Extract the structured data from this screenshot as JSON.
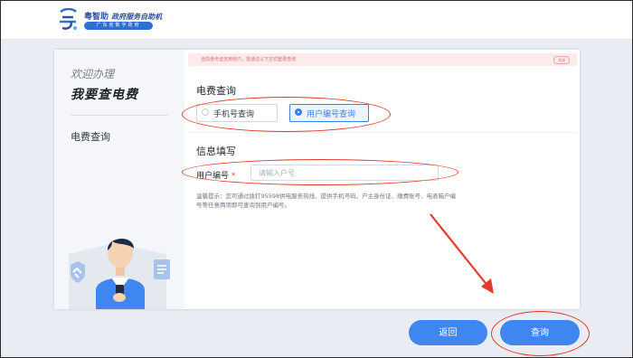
{
  "header": {
    "logo_icon": "yue-logo-icon",
    "brand_name": "粤智助",
    "brand_sub": "政府服务自助机",
    "brand_pill": "广东省数字政府"
  },
  "sidebar": {
    "welcome": "欢迎办理",
    "title": "我要查电费",
    "items": [
      {
        "label": "电费查询"
      }
    ]
  },
  "notice": {
    "text": "当前身份证无用电户，需通过以下方式登录查询",
    "close_label": "关闭"
  },
  "query": {
    "title": "电费查询",
    "options": [
      {
        "label": "手机号查询",
        "selected": false
      },
      {
        "label": "用户编号查询",
        "selected": true
      }
    ]
  },
  "info": {
    "title": "信息填写",
    "field_label": "用户编号",
    "required_mark": "*",
    "placeholder": "请输入户号",
    "value": ""
  },
  "hint": "温馨提示：您可通过拨打95598供电服务热线、提供手机号码、户主身份证、缴费账号、电表箱户编号等任意两项即可查询到用户编号。",
  "buttons": {
    "back": "返回",
    "submit": "查询"
  },
  "colors": {
    "accent": "#3f86f0",
    "annotation": "#e03b2b",
    "notice_bg": "#fdeaea"
  }
}
